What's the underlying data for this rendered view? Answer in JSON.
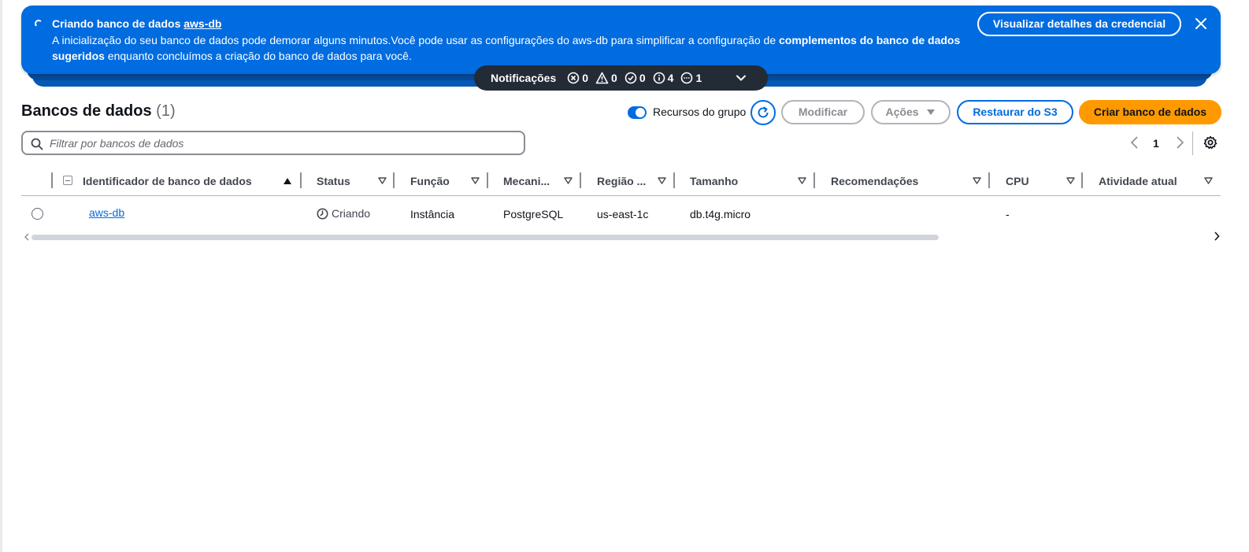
{
  "flash": {
    "title_prefix": "Criando banco de dados ",
    "title_db": "aws-db",
    "body_part1": "A inicialização do seu banco de dados pode demorar alguns minutos.Você pode usar as configurações do aws-db para simplificar a configuração de ",
    "body_bold": "complementos do banco de dados sugeridos",
    "body_part2": " enquanto concluímos a criação do banco de dados para você.",
    "credential_button": "Visualizar detalhes da credencial",
    "color": "#006ce0"
  },
  "notifications": {
    "label": "Notificações",
    "errors": "0",
    "warnings": "0",
    "success": "0",
    "info": "4",
    "in_progress": "1"
  },
  "header": {
    "title": "Bancos de dados",
    "count": "(1)",
    "group_toggle_label": "Recursos do grupo",
    "modify_button": "Modificar",
    "actions_button": "Ações",
    "restore_button": "Restaurar do S3",
    "create_button": "Criar banco de dados",
    "accent_color": "#ff9900"
  },
  "filter": {
    "placeholder": "Filtrar por bancos de dados",
    "value": ""
  },
  "pagination": {
    "current_page": "1"
  },
  "table": {
    "columns": [
      "Identificador de banco de dados",
      "Status",
      "Função",
      "Mecani...",
      "Região ...",
      "Tamanho",
      "Recomendações",
      "CPU",
      "Atividade atual"
    ],
    "rows": [
      {
        "identifier": "aws-db",
        "status": "Criando",
        "role": "Instância",
        "engine": "PostgreSQL",
        "region": "us-east-1c",
        "size": "db.t4g.micro",
        "recommendations": "",
        "cpu": "-",
        "activity": ""
      }
    ]
  }
}
